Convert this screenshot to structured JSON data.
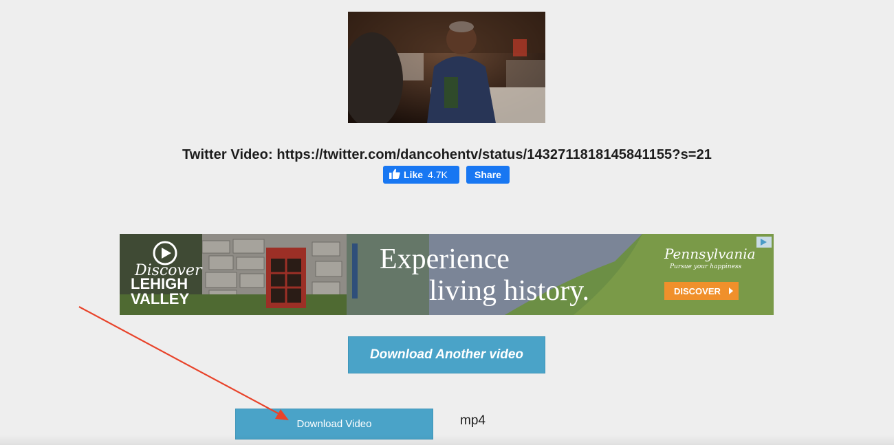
{
  "video": {
    "title": "Twitter Video: https://twitter.com/dancohentv/status/1432711818145841155?s=21"
  },
  "facebook": {
    "like_label": "Like",
    "like_count": "4.7K",
    "share_label": "Share",
    "brand_color": "#1877f2"
  },
  "ad": {
    "brand_line1": "Discover",
    "brand_line2": "LEHIGH",
    "brand_line3": "VALLEY",
    "headline1": "Experience",
    "headline2": "living history.",
    "sponsor": "Pennsylvania",
    "sponsor_tagline": "Pursue your happiness",
    "cta": "DISCOVER",
    "cta_color": "#f0902b"
  },
  "actions": {
    "download_another_label": "Download Another video",
    "download_label": "Download Video",
    "format": "mp4",
    "button_color": "#4aa3c8"
  },
  "annotation": {
    "arrow_color": "#e8432a"
  }
}
